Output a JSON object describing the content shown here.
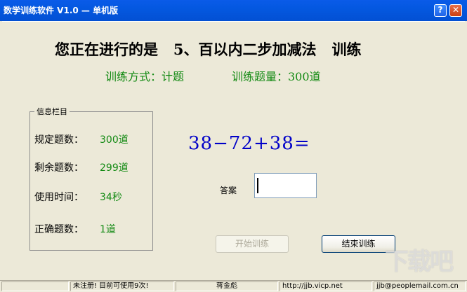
{
  "window": {
    "title": "数学训练软件 V1.0 — 单机版",
    "help_label": "?",
    "close_label": "✕"
  },
  "header": {
    "headline": "您正在进行的是   5、百以内二步加减法   训练",
    "mode": "训练方式：计题",
    "count": "训练题量：300道"
  },
  "info": {
    "group_title": "信息栏目",
    "rows": [
      {
        "label": "规定题数：",
        "value": "300道"
      },
      {
        "label": "剩余题数：",
        "value": "299道"
      },
      {
        "label": "使用时间：",
        "value": "34秒"
      },
      {
        "label": "正确题数：",
        "value": "1道"
      }
    ]
  },
  "question": {
    "equation": "38−72+38=",
    "answer_label": "答案",
    "answer_value": ""
  },
  "buttons": {
    "start": "开始训练",
    "end": "结束训练"
  },
  "statusbar": {
    "panes": [
      "",
      "未注册! 目前可使用9次!",
      "蒋金彪",
      "http://jjb.vicp.net",
      "jjb@peoplemail.com.cn"
    ]
  },
  "watermark": "下载吧"
}
